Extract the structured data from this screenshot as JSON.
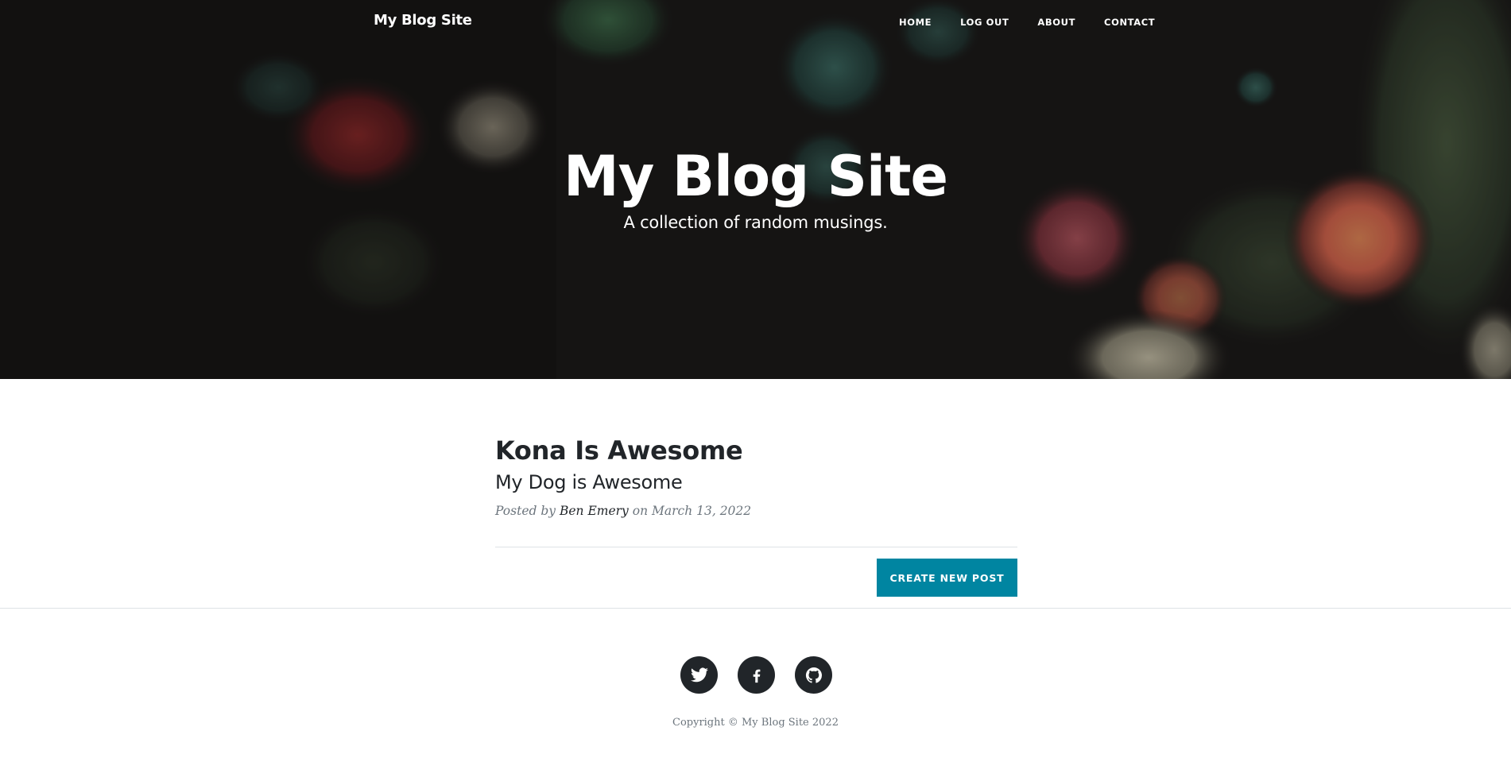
{
  "navbar": {
    "brand": "My Blog Site",
    "links": [
      "HOME",
      "LOG OUT",
      "ABOUT",
      "CONTACT"
    ]
  },
  "hero": {
    "title": "My Blog Site",
    "subtitle": "A collection of random musings."
  },
  "posts": [
    {
      "title": "Kona Is Awesome",
      "subtitle": "My Dog is Awesome",
      "meta_prefix": "Posted by",
      "author": "Ben Emery",
      "meta_on": "on",
      "date": "March 13, 2022"
    }
  ],
  "actions": {
    "create_post_label": "CREATE NEW POST"
  },
  "footer": {
    "social": [
      "twitter-icon",
      "facebook-icon",
      "github-icon"
    ],
    "copyright": "Copyright © My Blog Site 2022"
  },
  "colors": {
    "accent": "#0085a1",
    "text_dark": "#212529",
    "text_muted": "#6c757d"
  }
}
